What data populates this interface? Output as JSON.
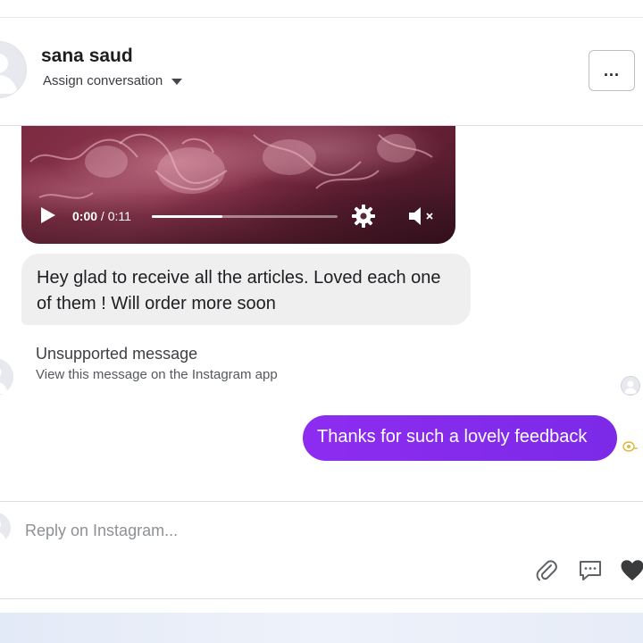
{
  "contact": {
    "name": "sana saud",
    "assign_label": "Assign conversation"
  },
  "header": {
    "more_button": "..."
  },
  "video": {
    "current_time": "0:00",
    "separator": " / ",
    "duration": "0:11",
    "progress_fraction": 0.38
  },
  "messages": {
    "incoming_text": "Hey glad to receive all the articles. Loved each one of them ! Will order more soon",
    "unsupported_title": "Unsupported message",
    "unsupported_subtitle": "View this message on the Instagram app",
    "outgoing_text": "Thanks for such a lovely feedback"
  },
  "composer": {
    "placeholder": "Reply on Instagram..."
  },
  "colors": {
    "outgoing_bubble": "#8a2be2",
    "incoming_bubble": "#efefef"
  },
  "icons": [
    "avatar-placeholder-icon",
    "caret-down-icon",
    "more-dots-icon",
    "play-icon",
    "gear-icon",
    "mute-icon",
    "seen-icon",
    "attach-icon",
    "sticker-icon",
    "heart-icon"
  ]
}
